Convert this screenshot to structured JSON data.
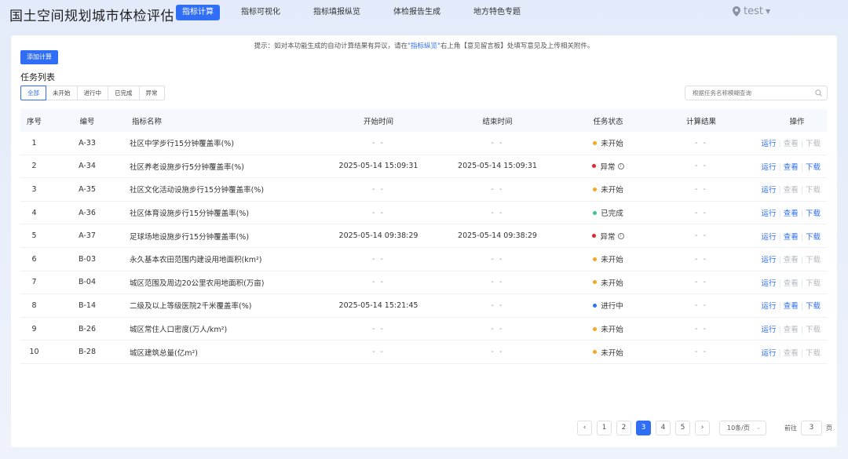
{
  "app_title": "国土空间规划城市体检评估",
  "nav": [
    "指标计算",
    "指标可视化",
    "指标填报纵览",
    "体检报告生成",
    "地方特色专题"
  ],
  "user": {
    "name": "test"
  },
  "hint": {
    "prefix": "提示：如对本功能生成的自动计算结果有异议，请在",
    "link": "\"指标纵览\"",
    "suffix": "右上角【意见留言板】处填写意见及上传相关附件。"
  },
  "add_button": "添加计算",
  "list_title": "任务列表",
  "filters": [
    "全部",
    "未开始",
    "进行中",
    "已完成",
    "异常"
  ],
  "search_placeholder": "根据任务名称模糊查询",
  "table": {
    "headers": [
      "序号",
      "编号",
      "指标名称",
      "开始时间",
      "结束时间",
      "任务状态",
      "计算结果",
      "操作"
    ],
    "rows": [
      {
        "no": "1",
        "code": "A-33",
        "name": "社区中学步行15分钟覆盖率(%)",
        "start": "- -",
        "end": "- -",
        "status": "未开始",
        "result": "- -"
      },
      {
        "no": "2",
        "code": "A-34",
        "name": "社区养老设施步行5分钟覆盖率(%)",
        "start": "2025-05-14 15:09:31",
        "end": "2025-05-14 15:09:31",
        "status": "异常",
        "result": "- -"
      },
      {
        "no": "3",
        "code": "A-35",
        "name": "社区文化活动设施步行15分钟覆盖率(%)",
        "start": "- -",
        "end": "- -",
        "status": "未开始",
        "result": "- -"
      },
      {
        "no": "4",
        "code": "A-36",
        "name": "社区体育设施步行15分钟覆盖率(%)",
        "start": "- -",
        "end": "- -",
        "status": "已完成",
        "result": "- -"
      },
      {
        "no": "5",
        "code": "A-37",
        "name": "足球场地设施步行15分钟覆盖率(%)",
        "start": "2025-05-14 09:38:29",
        "end": "2025-05-14 09:38:29",
        "status": "异常",
        "result": "- -"
      },
      {
        "no": "6",
        "code": "B-03",
        "name": "永久基本农田范围内建设用地面积(km²)",
        "start": "- -",
        "end": "- -",
        "status": "未开始",
        "result": "- -"
      },
      {
        "no": "7",
        "code": "B-04",
        "name": "城区范围及周边20公里农用地面积(万亩)",
        "start": "- -",
        "end": "- -",
        "status": "未开始",
        "result": "- -"
      },
      {
        "no": "8",
        "code": "B-14",
        "name": "二级及以上等级医院2千米覆盖率(%)",
        "start": "2025-05-14 15:21:45",
        "end": "- -",
        "status": "进行中",
        "result": "- -"
      },
      {
        "no": "9",
        "code": "B-26",
        "name": "城区常住人口密度(万人/km²)",
        "start": "- -",
        "end": "- -",
        "status": "未开始",
        "result": "- -"
      },
      {
        "no": "10",
        "code": "B-28",
        "name": "城区建筑总量(亿m²)",
        "start": "- -",
        "end": "- -",
        "status": "未开始",
        "result": "- -"
      }
    ],
    "ops": {
      "run": "运行",
      "view": "查看",
      "download": "下载"
    }
  },
  "status_colors": {
    "未开始": "#f5a623",
    "异常": "#e5242b",
    "已完成": "#3cc48c",
    "进行中": "#2f6ef5"
  },
  "pagination": {
    "pages": [
      "1",
      "2",
      "3",
      "4",
      "5"
    ],
    "current": "3",
    "page_size": "10条/页",
    "goto_label": "前往",
    "goto_value": "3",
    "goto_suffix": "页"
  }
}
